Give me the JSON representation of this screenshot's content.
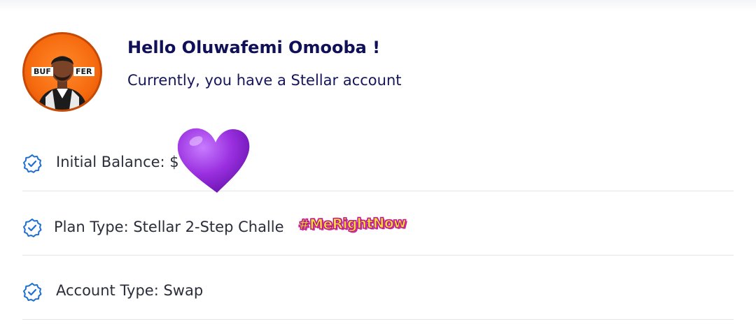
{
  "profile": {
    "avatar_left_tag": "BUF",
    "avatar_right_tag": "FER",
    "greeting": "Hello Oluwafemi Omooba !",
    "subtext": "Currently, you have a Stellar account"
  },
  "details": [
    {
      "label": "Initial Balance: $",
      "icon": "verified-badge-icon"
    },
    {
      "label": "Plan Type: Stellar 2-Step Challe",
      "icon": "verified-badge-icon"
    },
    {
      "label": "Account Type: Swap",
      "icon": "verified-badge-icon"
    }
  ],
  "overlays": {
    "sticker_text": "#MeRightNow",
    "heart_icon": "purple-heart-icon"
  },
  "colors": {
    "accent_blue": "#1e6fd1",
    "heading": "#0f1057",
    "avatar_orange": "#f66a0f",
    "heart_purple": "#9a2fe0"
  }
}
